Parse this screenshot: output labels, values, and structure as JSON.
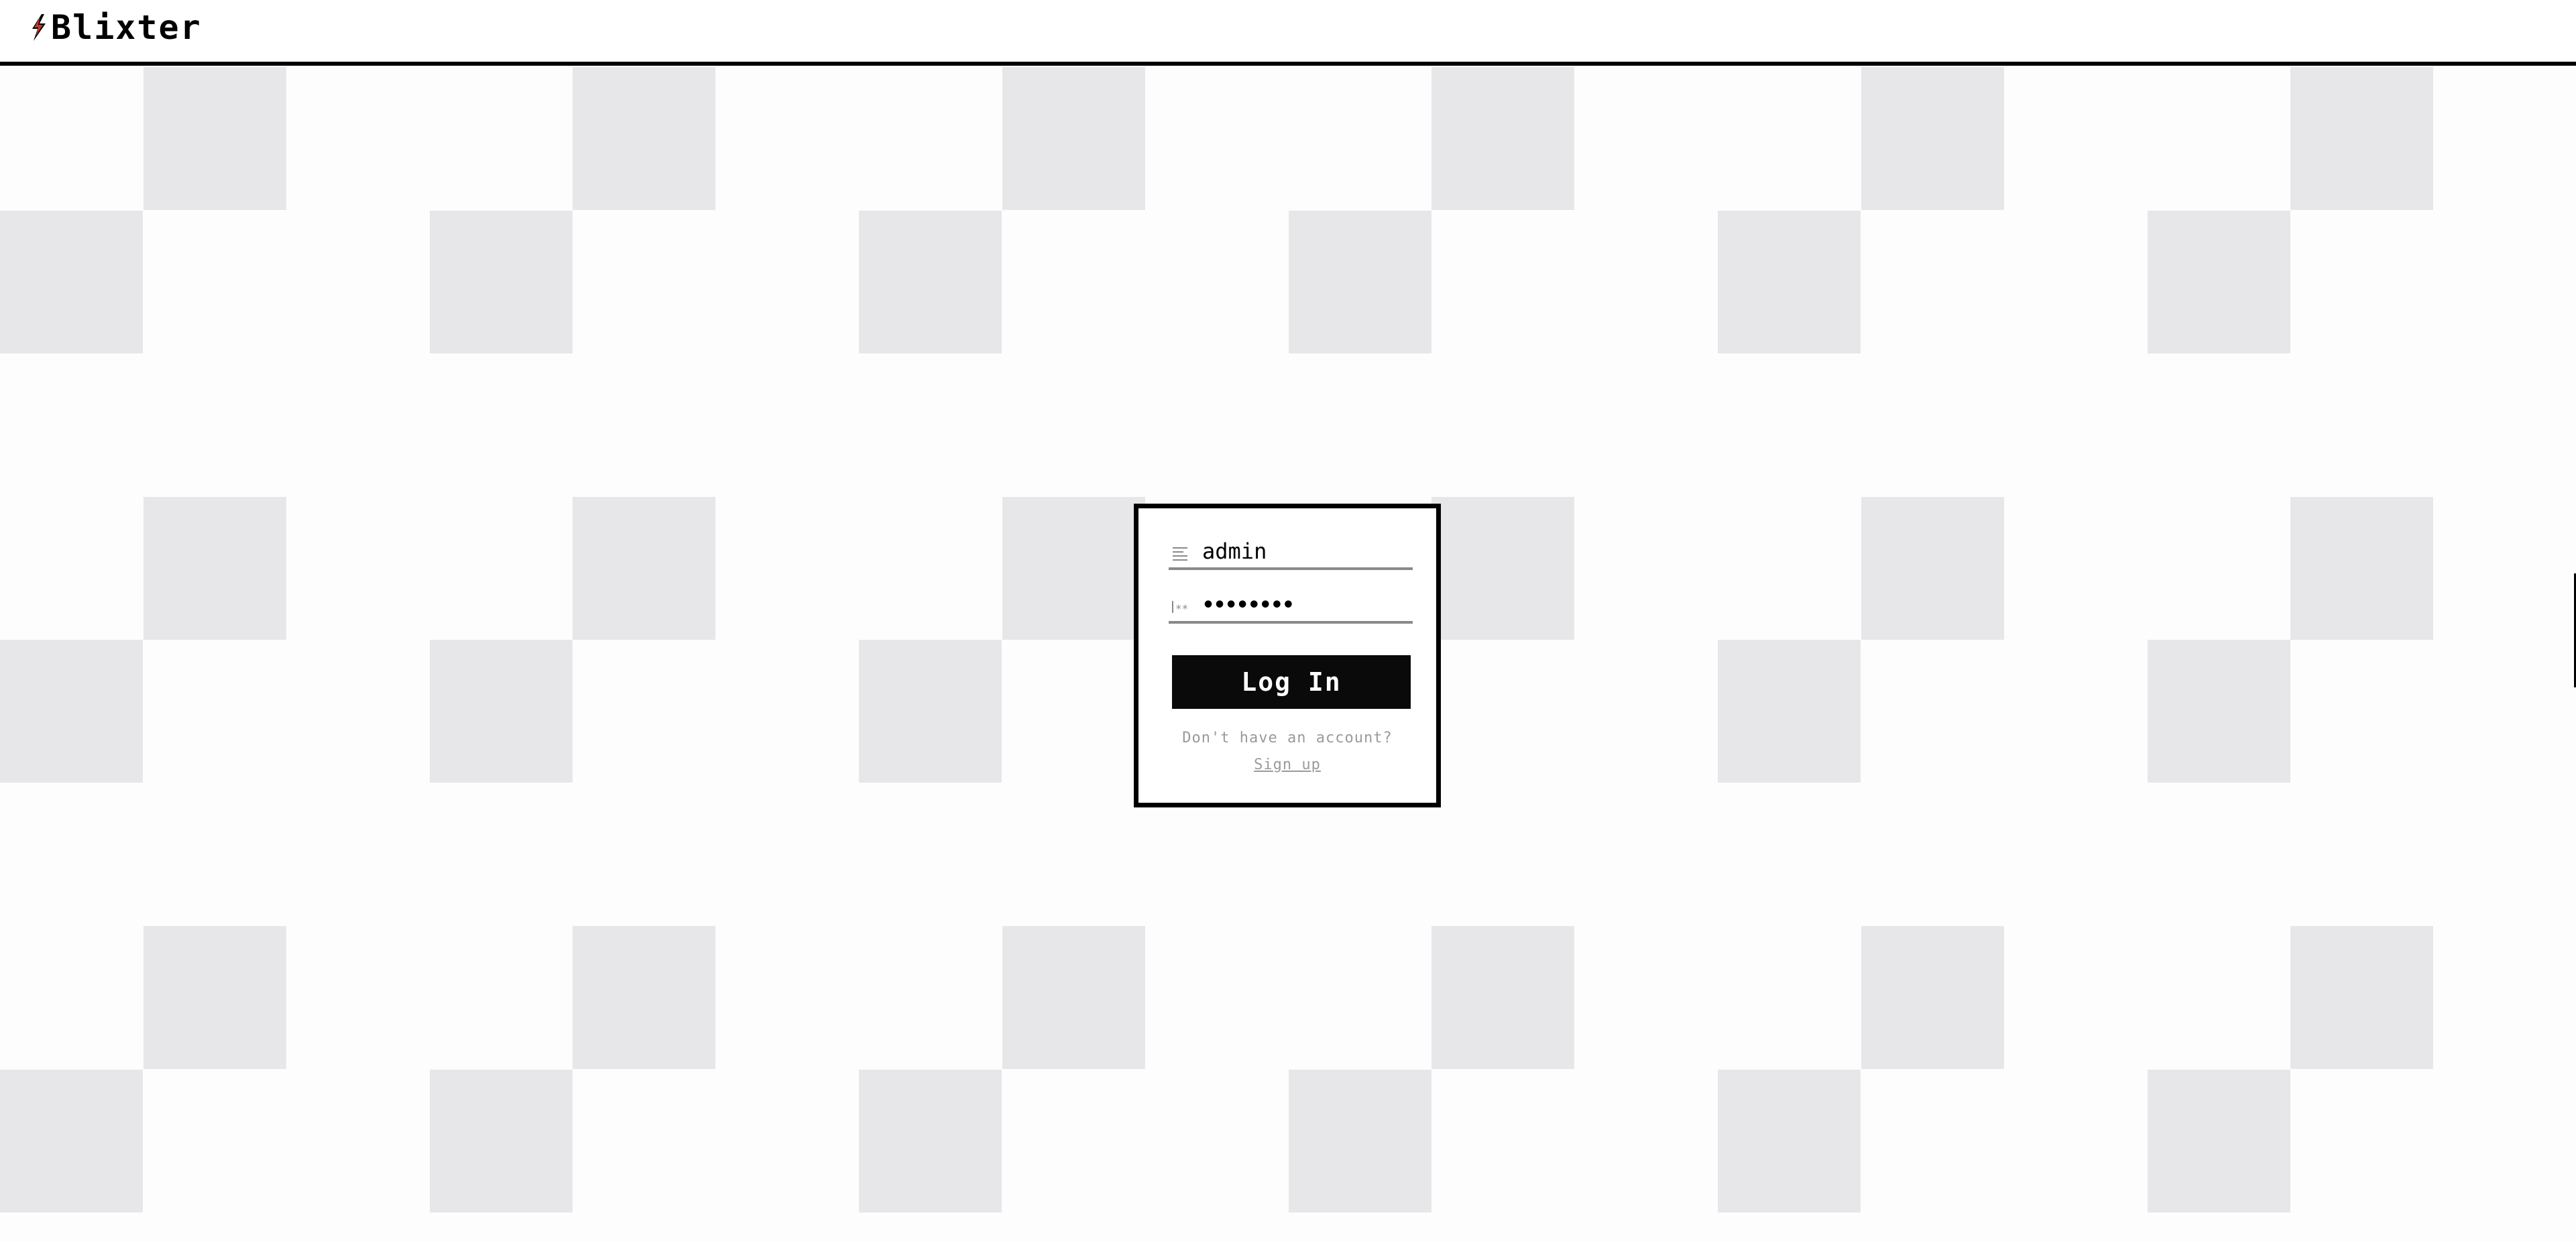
{
  "app": {
    "name": "Blixter",
    "logo_icon": "lightning-bolt-icon"
  },
  "colors": {
    "header_border": "#000000",
    "checker_square": "#e7e7e9",
    "background": "#fdfdfd",
    "button_bg": "#0a0a0a",
    "button_text": "#ffffff",
    "muted_text": "#9a9a9a",
    "logo_accent": "#c0392b"
  },
  "login": {
    "username_value": "admin",
    "username_icon": "text-lines-icon",
    "password_value": "••••••••",
    "password_icon": "password-icon",
    "submit_label": "Log In",
    "no_account_text": "Don't have an account?",
    "signup_link": "Sign up"
  }
}
